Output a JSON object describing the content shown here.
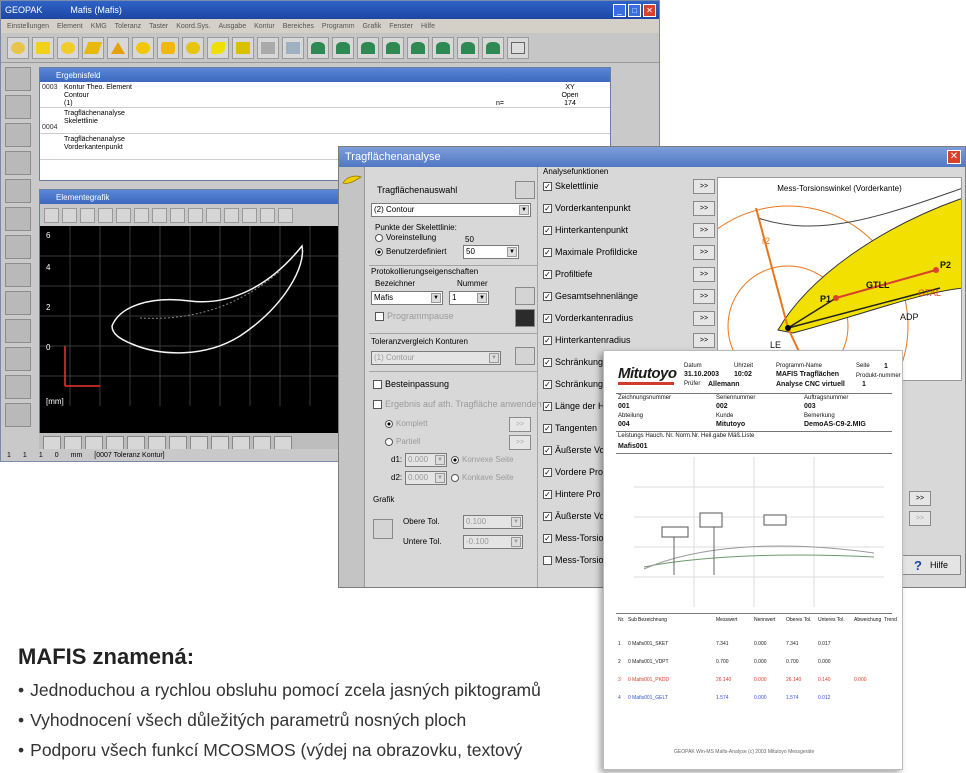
{
  "main_window": {
    "title": "GEOPAK",
    "doc_title": "Mafis (Mafis)",
    "menu": [
      "Einstellungen",
      "Element",
      "KMG",
      "Toleranz",
      "Taster",
      "Koord.Sys.",
      "Ausgabe",
      "Kontur",
      "Bereiches",
      "Programm",
      "Grafik",
      "Fenster",
      "Hilfe"
    ]
  },
  "results_window": {
    "title": "Ergebnisfeld",
    "rows": [
      {
        "num": "0003",
        "line1": "Kontur Theo. Element",
        "line2": "Contour",
        "line3": "(1)",
        "v1": "XY",
        "v2": "Open",
        "v3": "174",
        "mid": "n="
      },
      {
        "num": "0004",
        "line1": "Tragflächenanalyse",
        "line2": "Skelettlinie",
        "line3": "",
        "v1": "",
        "v2": "",
        "v3": "",
        "mid": ""
      },
      {
        "num": "",
        "line1": "Tragflächenanalyse",
        "line2": "Vorderkantenpunkt",
        "line3": "",
        "v1": "",
        "v2": "",
        "v3": "",
        "mid": ""
      }
    ]
  },
  "graphic_window": {
    "title": "Elementegrafik",
    "y_ticks": [
      "6",
      "4",
      "2",
      "0"
    ],
    "unit": "[mm]"
  },
  "status_bar": {
    "items": [
      "1",
      "1",
      "1",
      "0",
      "mm",
      "[0007 Toleranz Kontur]"
    ]
  },
  "dialog": {
    "title": "Tragflächenanalyse",
    "selection_label": "Tragflächenauswahl",
    "contour_value": "(2) Contour",
    "skeleton_points_label": "Punkte der Skelettlinie:",
    "preset_label": "Voreinstellung",
    "preset_value": "50",
    "user_label": "Benutzerdefiniert",
    "user_value": "50",
    "protocol_label": "Protokollierungseigenschaften",
    "designator_label": "Bezeichner",
    "number_label": "Nummer",
    "designator_value": "Mafis",
    "number_value": "1",
    "program_cb": "Programmpause",
    "tolerance_label": "Toleranzvergleich Konturen",
    "tolerance_value": "(1) Contour",
    "bestfit_cb": "Besteinpassung",
    "results_cb": "Ergebnis auf ath. Tragfläche anwenden",
    "complete": "Komplett",
    "partial": "Partiell",
    "d1": "d1:",
    "d1_value": "0.000",
    "d2": "d2:",
    "d2_value": "0.000",
    "convex": "Konvexe Seite",
    "concave": "Konkave Seite",
    "graphic": "Grafik",
    "upper_tol": "Obere Tol.",
    "upper_tol_value": "0.100",
    "lower_tol": "Untere Tol.",
    "lower_tol_value": "-0.100",
    "analysis_label": "Analysefunktionen",
    "analysis_items": [
      "Skelettlinie",
      "Vorderkantenpunkt",
      "Hinterkantenpunkt",
      "Maximale Profildicke",
      "Profiltiefe",
      "Gesamtsehnenlänge",
      "Vorderkantenradius",
      "Hinterkantenradius",
      "Schränkung (Profilsehne)",
      "Schränkung",
      "Länge der H",
      "Tangenten",
      "Äußerste Vo",
      "Vordere Pro",
      "Hintere Pro",
      "Äußerste Vo",
      "Mess-Torsio",
      "Mess-Torsio"
    ],
    "analysis_checked": [
      true,
      true,
      true,
      true,
      true,
      true,
      true,
      true,
      true,
      true,
      true,
      true,
      true,
      true,
      true,
      true,
      true,
      false
    ],
    "more_btn": ">>",
    "help": "Hilfe"
  },
  "measure_panel": {
    "title": "Mess-Torsionswinkel (Vorderkante)",
    "labels": [
      "P2",
      "GTLL",
      "GTAL",
      "P1",
      "ADP",
      "LE",
      "r1",
      "r2"
    ]
  },
  "report": {
    "logo": "Mitutoyo",
    "header": {
      "date_label": "Datum",
      "date": "31.10.2003",
      "time_label": "Uhrzeit",
      "time": "10:02",
      "program_label": "Programm-Name",
      "program": "MAFIS Tragflächen",
      "page_label": "Seite",
      "page": "1",
      "analysis": "Analyse CNC virtuell",
      "tester_label": "Prüfer",
      "tester": "Allemann",
      "prod_label": "Produkt-nummer",
      "prod": "1"
    },
    "fields": [
      [
        "Zeichnungsnummer",
        "Seriennummer",
        "Auftragsnummer"
      ],
      [
        "001",
        "002",
        "003"
      ],
      [
        "Abteilung",
        "Kunde",
        "Bemerkung"
      ],
      [
        "004",
        "Mitutoyo",
        "DemoAS-C9-2.MIG"
      ]
    ],
    "info_row": "Leistungs  Hauch.  Nr.  Norm.Nr.  Heil.gabe  Mäß.Liste",
    "part": "Mafis001",
    "table_header": [
      "Nr.",
      "Sub",
      "Bezeichnung",
      "Messwert",
      "Nennwert",
      "Oberes Tol.",
      "Unteres Tol.",
      "Abweichung",
      "Trend"
    ],
    "table_rows": [
      [
        "1",
        "0 Mafis001_SKET",
        "7.341",
        "0.000",
        "7.341",
        "0.017",
        ""
      ],
      [
        "2",
        "0 Mafis001_VDPT",
        "0.700",
        "0.000",
        "0.700",
        "0.000",
        ""
      ],
      [
        "3",
        "0 Mafis001_PKDD",
        "26.140",
        "0.000",
        "26.140",
        "0.140",
        "0.000"
      ],
      [
        "4",
        "0 Mafis001_GELT",
        "1.574",
        "0.000",
        "1.574",
        "0.012",
        ""
      ]
    ],
    "footer": "GEOPAK Win-MS Mafis-Analyse (c) 2003 Mitutoyo Messgeräte"
  },
  "info": {
    "heading": "MAFIS znamená:",
    "bullets": [
      "Jednoduchou a rychlou obsluhu pomocí zcela jasných piktogramů",
      "Vyhodnocení všech důležitých parametrů nosných ploch",
      "Podporu všech funkcí MCOSMOS (výdej na obrazovku, textový"
    ]
  },
  "colors": {
    "title_blue": "#1d46a3",
    "wing_yellow": "#f2e100",
    "accent_orange": "#e9761a",
    "accent_red": "#d9412b"
  }
}
